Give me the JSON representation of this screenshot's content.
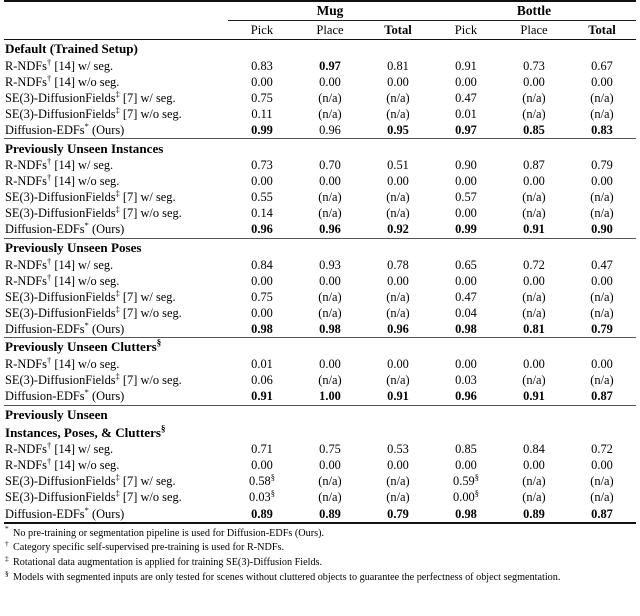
{
  "table": {
    "groups": [
      {
        "label": "Mug",
        "span": 3
      },
      {
        "label": "Bottle",
        "span": 3
      }
    ],
    "columns": [
      "Pick",
      "Place",
      "Total",
      "Pick",
      "Place",
      "Total"
    ],
    "sections": [
      {
        "title": "Default (Trained Setup)",
        "title_sup": "",
        "rows": [
          {
            "label": "R-NDFs",
            "label_sup": "†",
            "label_rest": " [14] w/ seg.",
            "cells": [
              {
                "v": "0.83",
                "bold": false
              },
              {
                "v": "0.97",
                "bold": true
              },
              {
                "v": "0.81",
                "bold": false
              },
              {
                "v": "0.91",
                "bold": false
              },
              {
                "v": "0.73",
                "bold": false
              },
              {
                "v": "0.67",
                "bold": false
              }
            ]
          },
          {
            "label": "R-NDFs",
            "label_sup": "†",
            "label_rest": " [14] w/o seg.",
            "cells": [
              {
                "v": "0.00",
                "bold": false
              },
              {
                "v": "0.00",
                "bold": false
              },
              {
                "v": "0.00",
                "bold": false
              },
              {
                "v": "0.00",
                "bold": false
              },
              {
                "v": "0.00",
                "bold": false
              },
              {
                "v": "0.00",
                "bold": false
              }
            ]
          },
          {
            "label": "SE(3)-DiffusionFields",
            "label_sup": "‡",
            "label_rest": " [7] w/ seg.",
            "cells": [
              {
                "v": "0.75",
                "bold": false
              },
              {
                "v": "(n/a)",
                "bold": false
              },
              {
                "v": "(n/a)",
                "bold": false
              },
              {
                "v": "0.47",
                "bold": false
              },
              {
                "v": "(n/a)",
                "bold": false
              },
              {
                "v": "(n/a)",
                "bold": false
              }
            ]
          },
          {
            "label": "SE(3)-DiffusionFields",
            "label_sup": "‡",
            "label_rest": " [7] w/o seg.",
            "cells": [
              {
                "v": "0.11",
                "bold": false
              },
              {
                "v": "(n/a)",
                "bold": false
              },
              {
                "v": "(n/a)",
                "bold": false
              },
              {
                "v": "0.01",
                "bold": false
              },
              {
                "v": "(n/a)",
                "bold": false
              },
              {
                "v": "(n/a)",
                "bold": false
              }
            ]
          },
          {
            "label": "Diffusion-EDFs",
            "label_sup": "*",
            "label_rest": " (Ours)",
            "cells": [
              {
                "v": "0.99",
                "bold": true
              },
              {
                "v": "0.96",
                "bold": false
              },
              {
                "v": "0.95",
                "bold": true
              },
              {
                "v": "0.97",
                "bold": true
              },
              {
                "v": "0.85",
                "bold": true
              },
              {
                "v": "0.83",
                "bold": true
              }
            ]
          }
        ]
      },
      {
        "title": "Previously Unseen Instances",
        "title_sup": "",
        "rows": [
          {
            "label": "R-NDFs",
            "label_sup": "†",
            "label_rest": " [14] w/ seg.",
            "cells": [
              {
                "v": "0.73",
                "bold": false
              },
              {
                "v": "0.70",
                "bold": false
              },
              {
                "v": "0.51",
                "bold": false
              },
              {
                "v": "0.90",
                "bold": false
              },
              {
                "v": "0.87",
                "bold": false
              },
              {
                "v": "0.79",
                "bold": false
              }
            ]
          },
          {
            "label": "R-NDFs",
            "label_sup": "†",
            "label_rest": " [14] w/o seg.",
            "cells": [
              {
                "v": "0.00",
                "bold": false
              },
              {
                "v": "0.00",
                "bold": false
              },
              {
                "v": "0.00",
                "bold": false
              },
              {
                "v": "0.00",
                "bold": false
              },
              {
                "v": "0.00",
                "bold": false
              },
              {
                "v": "0.00",
                "bold": false
              }
            ]
          },
          {
            "label": "SE(3)-DiffusionFields",
            "label_sup": "‡",
            "label_rest": " [7] w/ seg.",
            "cells": [
              {
                "v": "0.55",
                "bold": false
              },
              {
                "v": "(n/a)",
                "bold": false
              },
              {
                "v": "(n/a)",
                "bold": false
              },
              {
                "v": "0.57",
                "bold": false
              },
              {
                "v": "(n/a)",
                "bold": false
              },
              {
                "v": "(n/a)",
                "bold": false
              }
            ]
          },
          {
            "label": "SE(3)-DiffusionFields",
            "label_sup": "‡",
            "label_rest": " [7] w/o seg.",
            "cells": [
              {
                "v": "0.14",
                "bold": false
              },
              {
                "v": "(n/a)",
                "bold": false
              },
              {
                "v": "(n/a)",
                "bold": false
              },
              {
                "v": "0.00",
                "bold": false
              },
              {
                "v": "(n/a)",
                "bold": false
              },
              {
                "v": "(n/a)",
                "bold": false
              }
            ]
          },
          {
            "label": "Diffusion-EDFs",
            "label_sup": "*",
            "label_rest": " (Ours)",
            "cells": [
              {
                "v": "0.96",
                "bold": true
              },
              {
                "v": "0.96",
                "bold": true
              },
              {
                "v": "0.92",
                "bold": true
              },
              {
                "v": "0.99",
                "bold": true
              },
              {
                "v": "0.91",
                "bold": true
              },
              {
                "v": "0.90",
                "bold": true
              }
            ]
          }
        ]
      },
      {
        "title": "Previously Unseen Poses",
        "title_sup": "",
        "rows": [
          {
            "label": "R-NDFs",
            "label_sup": "†",
            "label_rest": " [14] w/ seg.",
            "cells": [
              {
                "v": "0.84",
                "bold": false
              },
              {
                "v": "0.93",
                "bold": false
              },
              {
                "v": "0.78",
                "bold": false
              },
              {
                "v": "0.65",
                "bold": false
              },
              {
                "v": "0.72",
                "bold": false
              },
              {
                "v": "0.47",
                "bold": false
              }
            ]
          },
          {
            "label": "R-NDFs",
            "label_sup": "†",
            "label_rest": " [14] w/o seg.",
            "cells": [
              {
                "v": "0.00",
                "bold": false
              },
              {
                "v": "0.00",
                "bold": false
              },
              {
                "v": "0.00",
                "bold": false
              },
              {
                "v": "0.00",
                "bold": false
              },
              {
                "v": "0.00",
                "bold": false
              },
              {
                "v": "0.00",
                "bold": false
              }
            ]
          },
          {
            "label": "SE(3)-DiffusionFields",
            "label_sup": "‡",
            "label_rest": " [7] w/ seg.",
            "cells": [
              {
                "v": "0.75",
                "bold": false
              },
              {
                "v": "(n/a)",
                "bold": false
              },
              {
                "v": "(n/a)",
                "bold": false
              },
              {
                "v": "0.47",
                "bold": false
              },
              {
                "v": "(n/a)",
                "bold": false
              },
              {
                "v": "(n/a)",
                "bold": false
              }
            ]
          },
          {
            "label": "SE(3)-DiffusionFields",
            "label_sup": "‡",
            "label_rest": " [7] w/o seg.",
            "cells": [
              {
                "v": "0.00",
                "bold": false
              },
              {
                "v": "(n/a)",
                "bold": false
              },
              {
                "v": "(n/a)",
                "bold": false
              },
              {
                "v": "0.04",
                "bold": false
              },
              {
                "v": "(n/a)",
                "bold": false
              },
              {
                "v": "(n/a)",
                "bold": false
              }
            ]
          },
          {
            "label": "Diffusion-EDFs",
            "label_sup": "*",
            "label_rest": " (Ours)",
            "cells": [
              {
                "v": "0.98",
                "bold": true
              },
              {
                "v": "0.98",
                "bold": true
              },
              {
                "v": "0.96",
                "bold": true
              },
              {
                "v": "0.98",
                "bold": true
              },
              {
                "v": "0.81",
                "bold": true
              },
              {
                "v": "0.79",
                "bold": true
              }
            ]
          }
        ]
      },
      {
        "title": "Previously Unseen Clutters",
        "title_sup": "§",
        "rows": [
          {
            "label": "R-NDFs",
            "label_sup": "†",
            "label_rest": " [14] w/o seg.",
            "cells": [
              {
                "v": "0.01",
                "bold": false
              },
              {
                "v": "0.00",
                "bold": false
              },
              {
                "v": "0.00",
                "bold": false
              },
              {
                "v": "0.00",
                "bold": false
              },
              {
                "v": "0.00",
                "bold": false
              },
              {
                "v": "0.00",
                "bold": false
              }
            ]
          },
          {
            "label": "SE(3)-DiffusionFields",
            "label_sup": "‡",
            "label_rest": " [7] w/o seg.",
            "cells": [
              {
                "v": "0.06",
                "bold": false
              },
              {
                "v": "(n/a)",
                "bold": false
              },
              {
                "v": "(n/a)",
                "bold": false
              },
              {
                "v": "0.03",
                "bold": false
              },
              {
                "v": "(n/a)",
                "bold": false
              },
              {
                "v": "(n/a)",
                "bold": false
              }
            ]
          },
          {
            "label": "Diffusion-EDFs",
            "label_sup": "*",
            "label_rest": " (Ours)",
            "cells": [
              {
                "v": "0.91",
                "bold": true
              },
              {
                "v": "1.00",
                "bold": true
              },
              {
                "v": "0.91",
                "bold": true
              },
              {
                "v": "0.96",
                "bold": true
              },
              {
                "v": "0.91",
                "bold": true
              },
              {
                "v": "0.87",
                "bold": true
              }
            ]
          }
        ]
      },
      {
        "title": "Previously Unseen",
        "title_line2": "Instances, Poses, & Clutters",
        "title_sup": "",
        "title_line2_sup": "§",
        "rows": [
          {
            "label": "R-NDFs",
            "label_sup": "†",
            "label_rest": " [14] w/ seg.",
            "cells": [
              {
                "v": "0.71",
                "bold": false
              },
              {
                "v": "0.75",
                "bold": false
              },
              {
                "v": "0.53",
                "bold": false
              },
              {
                "v": "0.85",
                "bold": false
              },
              {
                "v": "0.84",
                "bold": false
              },
              {
                "v": "0.72",
                "bold": false
              }
            ]
          },
          {
            "label": "R-NDFs",
            "label_sup": "†",
            "label_rest": " [14] w/o seg.",
            "cells": [
              {
                "v": "0.00",
                "bold": false
              },
              {
                "v": "0.00",
                "bold": false
              },
              {
                "v": "0.00",
                "bold": false
              },
              {
                "v": "0.00",
                "bold": false
              },
              {
                "v": "0.00",
                "bold": false
              },
              {
                "v": "0.00",
                "bold": false
              }
            ]
          },
          {
            "label": "SE(3)-DiffusionFields",
            "label_sup": "‡",
            "label_rest": " [7] w/ seg.",
            "cells": [
              {
                "v": "0.58",
                "bold": false,
                "sup": "§"
              },
              {
                "v": "(n/a)",
                "bold": false
              },
              {
                "v": "(n/a)",
                "bold": false
              },
              {
                "v": "0.59",
                "bold": false,
                "sup": "§"
              },
              {
                "v": "(n/a)",
                "bold": false
              },
              {
                "v": "(n/a)",
                "bold": false
              }
            ]
          },
          {
            "label": "SE(3)-DiffusionFields",
            "label_sup": "‡",
            "label_rest": " [7] w/o seg.",
            "cells": [
              {
                "v": "0.03",
                "bold": false,
                "sup": "§"
              },
              {
                "v": "(n/a)",
                "bold": false
              },
              {
                "v": "(n/a)",
                "bold": false
              },
              {
                "v": "0.00",
                "bold": false,
                "sup": "§"
              },
              {
                "v": "(n/a)",
                "bold": false
              },
              {
                "v": "(n/a)",
                "bold": false
              }
            ]
          },
          {
            "label": "Diffusion-EDFs",
            "label_sup": "*",
            "label_rest": " (Ours)",
            "cells": [
              {
                "v": "0.89",
                "bold": true
              },
              {
                "v": "0.89",
                "bold": true
              },
              {
                "v": "0.79",
                "bold": true
              },
              {
                "v": "0.98",
                "bold": true
              },
              {
                "v": "0.89",
                "bold": true
              },
              {
                "v": "0.87",
                "bold": true
              }
            ]
          }
        ]
      }
    ]
  },
  "footnotes": [
    {
      "marker": "*",
      "text": "No pre-training or segmentation pipeline is used for Diffusion-EDFs (Ours)."
    },
    {
      "marker": "†",
      "text": "Category specific self-supervised pre-training is used for R-NDFs."
    },
    {
      "marker": "‡",
      "text": "Rotational data augmentation is applied for training SE(3)-Diffusion Fields."
    },
    {
      "marker": "§",
      "text": "Models with segmented inputs are only tested for scenes without cluttered objects to guarantee the perfectness of object segmentation."
    }
  ]
}
